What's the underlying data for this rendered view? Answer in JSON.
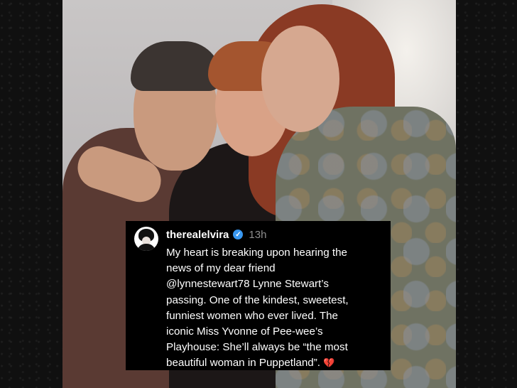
{
  "post": {
    "username": "therealelvira",
    "time": "13h",
    "caption": "My heart is breaking upon hearing the\nnews of my dear friend\n@lynnestewart78 Lynne Stewart’s\npassing. One of the kindest, sweetest,\nfunniest women who ever lived. The\niconic Miss Yvonne of Pee-wee’s\nPlayhouse: She’ll always be “the most\nbeautiful woman in Puppetland”.",
    "emoji": "💔",
    "verified_color": "#3897f0"
  },
  "icons": {
    "verified": "verified-badge-icon",
    "avatar": "profile-avatar-icon"
  }
}
